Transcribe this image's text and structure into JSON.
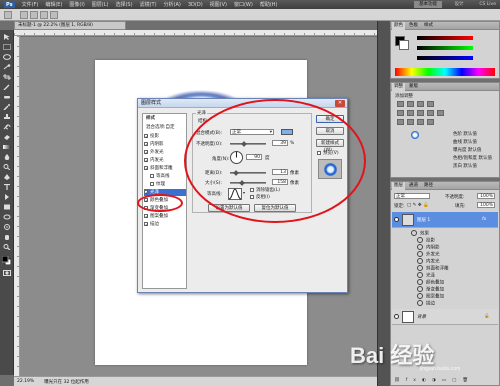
{
  "app": {
    "logo": "Ps",
    "menus": [
      "文件(F)",
      "编辑(E)",
      "图像(I)",
      "图层(L)",
      "选择(S)",
      "滤镜(T)",
      "分析(A)",
      "3D(D)",
      "视图(V)",
      "窗口(W)",
      "帮助(H)"
    ],
    "workspace": "基本功能",
    "design": "设计",
    "cslive": "CS Live"
  },
  "document": {
    "tab": "未标题-1 @ 22.2% (图层 1, RGB/8)",
    "zoom": "22.19%",
    "status": "曝光只在 32 位起作用"
  },
  "dialog": {
    "title": "图层样式",
    "styles_header": "样式",
    "blend_options": "混合选项:自定",
    "styles": [
      {
        "label": "投影",
        "checked": true
      },
      {
        "label": "内阴影",
        "checked": true
      },
      {
        "label": "外发光",
        "checked": true
      },
      {
        "label": "内发光",
        "checked": true
      },
      {
        "label": "斜面和浮雕",
        "checked": true
      },
      {
        "label": "等高线",
        "checked": false
      },
      {
        "label": "纹理",
        "checked": false
      },
      {
        "label": "光泽",
        "checked": true,
        "selected": true
      },
      {
        "label": "颜色叠加",
        "checked": true
      },
      {
        "label": "渐变叠加",
        "checked": true
      },
      {
        "label": "图案叠加",
        "checked": true
      },
      {
        "label": "描边",
        "checked": true
      }
    ],
    "group_title": "光泽",
    "sub_title": "结构",
    "blend_mode_label": "混合模式(B):",
    "blend_mode_value": "正常",
    "opacity_label": "不透明度(O):",
    "opacity_value": "39",
    "opacity_unit": "%",
    "angle_label": "角度(N):",
    "angle_value": "90",
    "angle_unit": "度",
    "distance_label": "距离(D):",
    "distance_value": "13",
    "distance_unit": "像素",
    "size_label": "大小(S):",
    "size_value": "158",
    "size_unit": "像素",
    "contour_label": "等高线:",
    "antialias_label": "消除锯齿(L)",
    "invert_label": "反相(I)",
    "set_default": "设置为默认值",
    "reset_default": "复位为默认值",
    "ok": "确定",
    "cancel": "取消",
    "new_style": "新建样式(W)...",
    "preview_label": "预览(V)",
    "accent_color": "#7fb0ea"
  },
  "panels": {
    "color_tabs": [
      "颜色",
      "色板",
      "样式"
    ],
    "adjust_tabs": [
      "调整",
      "蒙版"
    ],
    "adjust_title": "添加调整",
    "preset_labels": [
      "色阶 默认值",
      "曲线 默认值",
      "曝光度 默认值",
      "色相/饱和度 默认值",
      "黑白 默认值"
    ],
    "layers_tabs": [
      "图层",
      "通道",
      "路径"
    ],
    "blend_mode": "正常",
    "opacity_label": "不透明度:",
    "opacity_value": "100%",
    "lock_label": "锁定:",
    "fill_label": "填充:",
    "fill_value": "100%",
    "layer1": "图层 1",
    "fx": "fx",
    "effects_label": "效果",
    "effects": [
      "投影",
      "内阴影",
      "外发光",
      "内发光",
      "斜面和浮雕",
      "光泽",
      "颜色叠加",
      "渐变叠加",
      "图案叠加",
      "描边"
    ],
    "background": "背景"
  },
  "watermark": {
    "text": "Bai 经验",
    "url": "jingyan.baidu.com"
  }
}
